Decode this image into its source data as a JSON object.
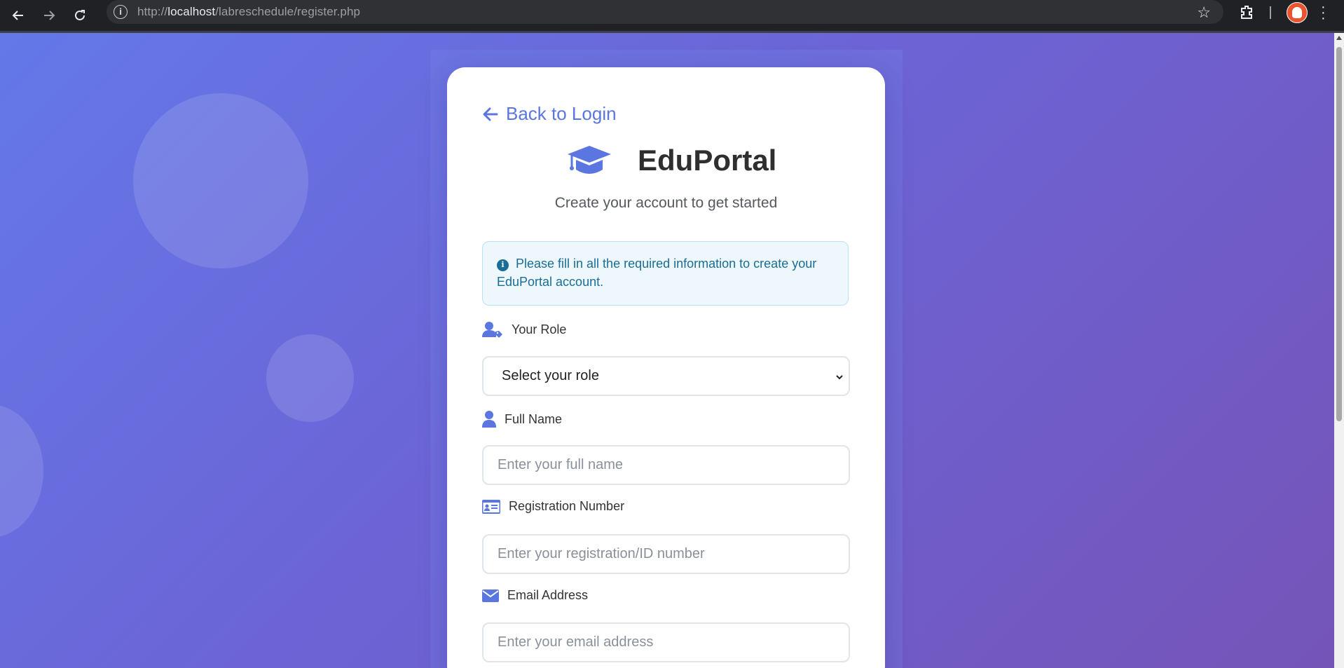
{
  "browser": {
    "url_prefix": "http://",
    "url_host": "localhost",
    "url_path": "/labreschedule/register.php"
  },
  "page": {
    "back_link": "Back to Login",
    "brand_name": "EduPortal",
    "subtitle": "Create your account to get started",
    "alert_text": "Please fill in all the required information to create your EduPortal account."
  },
  "form": {
    "role": {
      "label": "Your Role",
      "selected": "Select your role"
    },
    "full_name": {
      "label": "Full Name",
      "placeholder": "Enter your full name"
    },
    "registration": {
      "label": "Registration Number",
      "placeholder": "Enter your registration/ID number"
    },
    "email": {
      "label": "Email Address",
      "placeholder": "Enter your email address"
    }
  },
  "colors": {
    "accent": "#5b76e0",
    "alert_text": "#1a6e96",
    "alert_bg": "#edf7fc"
  },
  "icons": [
    "back-icon",
    "forward-icon",
    "reload-icon",
    "info-icon",
    "star-icon",
    "extensions-icon",
    "avatar",
    "menu-icon",
    "arrow-left-icon",
    "graduation-cap-icon",
    "info-circle-icon",
    "user-tag-icon",
    "user-icon",
    "id-card-icon",
    "envelope-icon",
    "chevron-down-icon"
  ]
}
